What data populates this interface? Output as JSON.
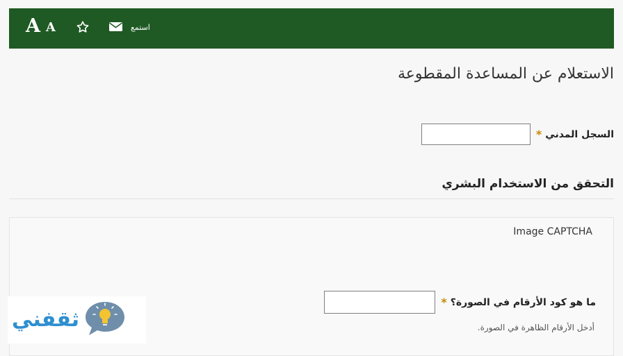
{
  "toolbar": {
    "font_large_label": "A",
    "font_small_label": "A",
    "star_icon": "star-outline-icon",
    "mail_icon": "envelope-icon",
    "listen_label": "استمع",
    "background_color": "#1f5a24"
  },
  "page": {
    "title": "الاستعلام عن المساعدة المقطوعة"
  },
  "civil_registry": {
    "label": "السجل المدني",
    "required_mark": "*",
    "value": ""
  },
  "captcha": {
    "section_title": "التحقق من الاستخدام البشري",
    "image_label": "Image CAPTCHA",
    "question_label": "ما هو كود الأرقام في الصورة؟",
    "required_mark": "*",
    "value": "",
    "help_text": "أدخل الأرقام الظاهرة في الصورة."
  },
  "watermark": {
    "text": "ثقفني",
    "icon": "lightbulb-chat-icon"
  }
}
